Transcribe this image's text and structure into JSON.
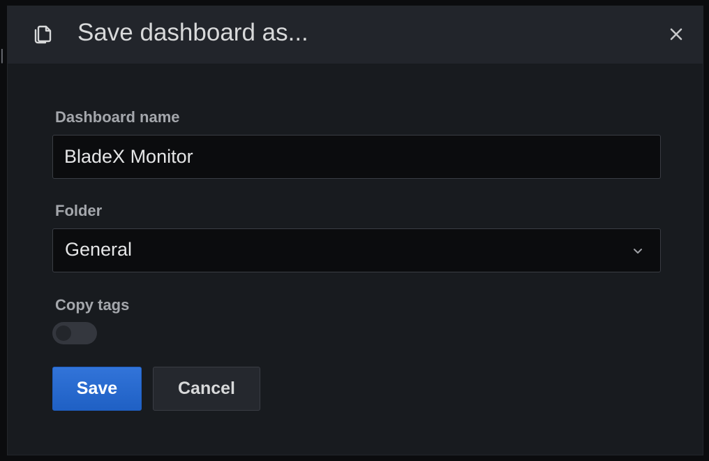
{
  "modal": {
    "title": "Save dashboard as...",
    "title_icon": "copy-icon",
    "close_icon": "close-icon"
  },
  "form": {
    "dashboard_name": {
      "label": "Dashboard name",
      "value": "BladeX Monitor"
    },
    "folder": {
      "label": "Folder",
      "selected": "General",
      "icon": "chevron-down-icon"
    },
    "copy_tags": {
      "label": "Copy tags",
      "enabled": false
    }
  },
  "actions": {
    "save_label": "Save",
    "cancel_label": "Cancel"
  },
  "colors": {
    "primary": "#1f60c4",
    "modal_bg": "#181b1f",
    "header_bg": "#22252b",
    "input_bg": "#0b0c0e"
  }
}
